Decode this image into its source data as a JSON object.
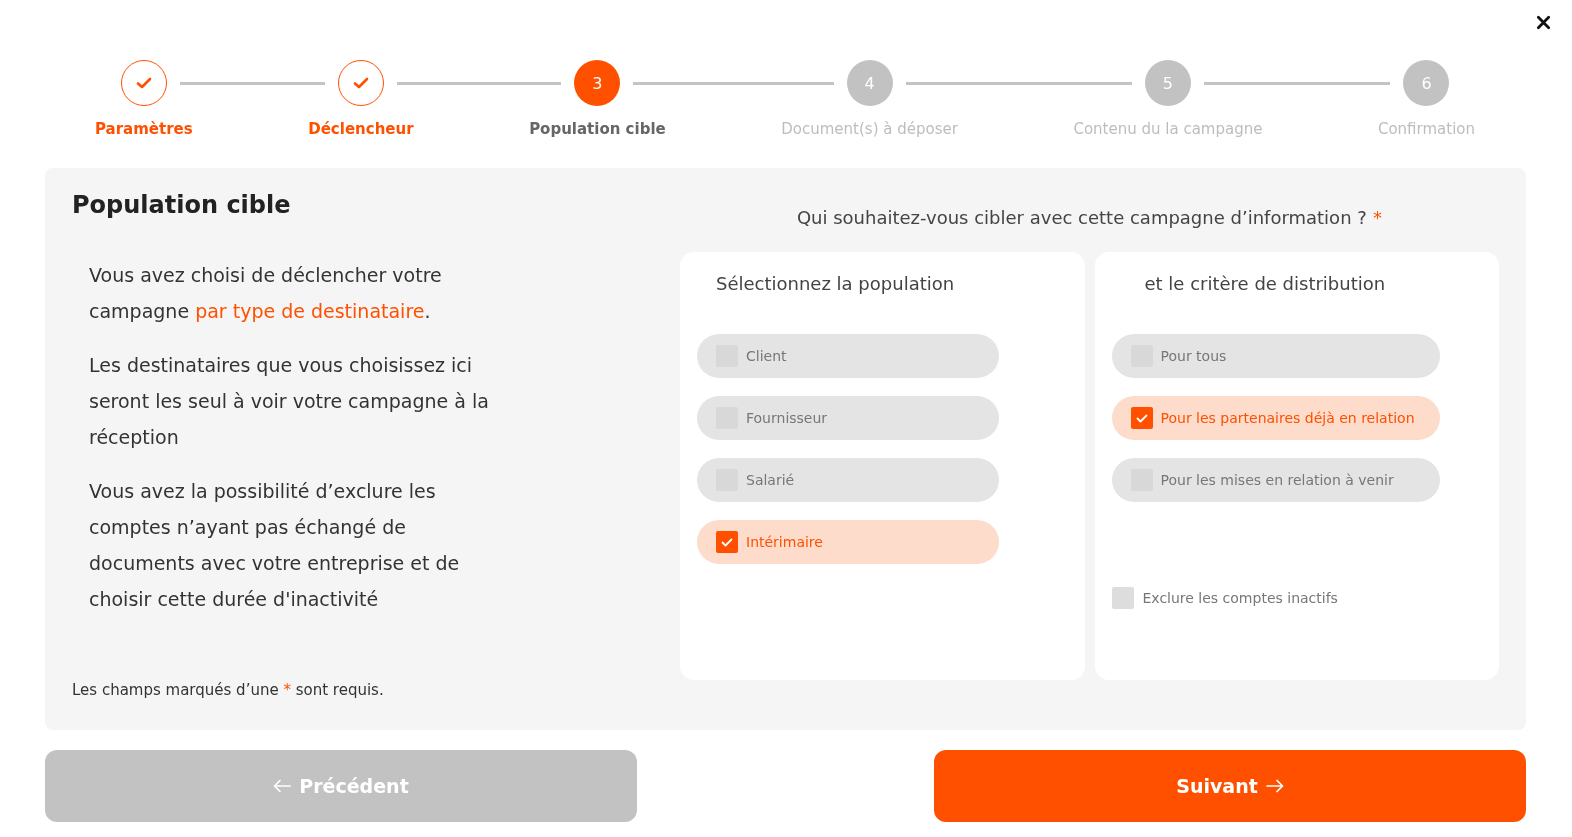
{
  "steps": [
    {
      "label": "Paramètres",
      "completed": true,
      "selected": false
    },
    {
      "label": "Déclencheur",
      "completed": true,
      "selected": false
    },
    {
      "number": "3",
      "label": "Population cible",
      "completed": false,
      "selected": true
    },
    {
      "number": "4",
      "label": "Document(s) à déposer",
      "completed": false,
      "selected": false
    },
    {
      "number": "5",
      "label": "Contenu du la campagne",
      "completed": false,
      "selected": false
    },
    {
      "number": "6",
      "label": "Confirmation",
      "completed": false,
      "selected": false
    }
  ],
  "panel": {
    "title": "Population cible",
    "intro": {
      "text_before": "Vous avez choisi de déclencher votre campagne ",
      "link": "par type de destinataire",
      "text_after": "."
    },
    "paragraphs": [
      "Les destinataires que vous choisissez ici seront les seul à voir votre campagne à la réception",
      "Vous avez la possibilité d’exclure les comptes n’ayant pas échangé de documents avec votre entreprise et de choisir cette durée d'inactivité"
    ],
    "required_note": {
      "before": "Les champs marqués d’une ",
      "mark": "*",
      "after": " sont requis."
    },
    "question": {
      "text": "Qui souhaitez-vous cibler avec cette campagne d’information ?",
      "mark": "*"
    },
    "population": {
      "title": "Sélectionnez la population",
      "options": [
        {
          "label": "Client",
          "selected": false
        },
        {
          "label": "Fournisseur",
          "selected": false
        },
        {
          "label": "Salarié",
          "selected": false
        },
        {
          "label": "Intérimaire",
          "selected": true
        }
      ]
    },
    "distribution": {
      "title": "et le critère de distribution",
      "options": [
        {
          "label": "Pour tous",
          "selected": false
        },
        {
          "label": "Pour les partenaires déjà en relation",
          "selected": true
        },
        {
          "label": "Pour les mises en relation à venir",
          "selected": false
        }
      ],
      "exclude_inactive": {
        "label": "Exclure les comptes inactifs",
        "checked": false
      }
    }
  },
  "buttons": [
    {
      "label": "Précédent",
      "kind": "back"
    },
    {
      "label": "Suivant",
      "kind": "next"
    }
  ]
}
